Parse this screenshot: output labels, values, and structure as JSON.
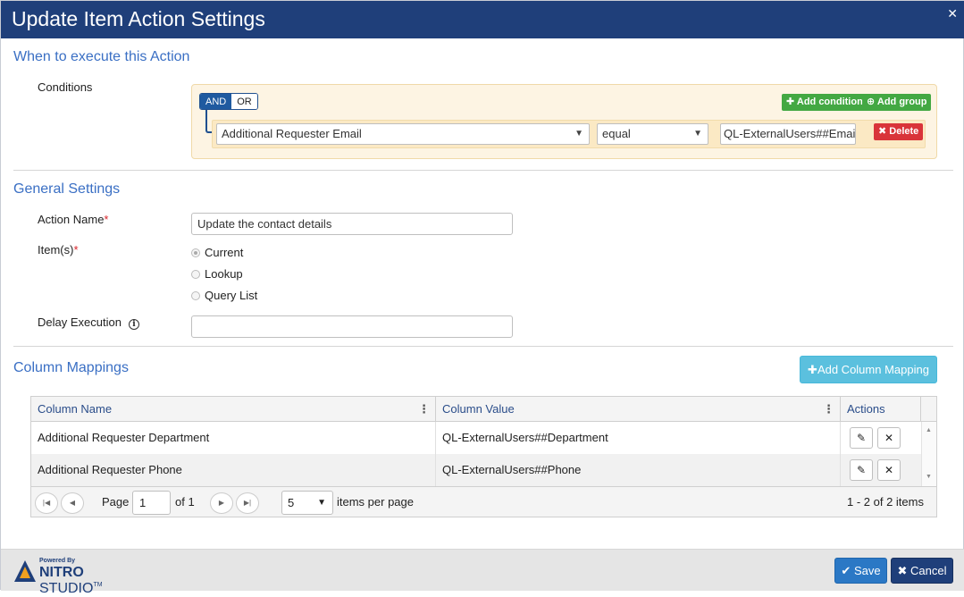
{
  "dialog": {
    "title": "Update Item Action Settings",
    "close_icon": "close-icon"
  },
  "when": {
    "section_title": "When to execute this Action",
    "conditions_label": "Conditions",
    "and_label": "AND",
    "or_label": "OR",
    "add_condition_label": "Add condition",
    "add_group_label": "Add group",
    "condition": {
      "field": "Additional Requester Email",
      "operator": "equal",
      "value": "QL-ExternalUsers##Email",
      "delete_label": "Delete"
    }
  },
  "general": {
    "section_title": "General Settings",
    "action_name_label": "Action Name",
    "action_name_value": "Update the contact details",
    "items_label": "Item(s)",
    "items_options": [
      "Current",
      "Lookup",
      "Query List"
    ],
    "items_selected": "Current",
    "delay_label": "Delay Execution",
    "delay_value": "",
    "required_mark": "*"
  },
  "mappings": {
    "section_title": "Column Mappings",
    "add_button_label": "Add Column Mapping",
    "columns": [
      "Column Name",
      "Column Value",
      "Actions"
    ],
    "rows": [
      {
        "name": "Additional Requester Department",
        "value": "QL-ExternalUsers##Department"
      },
      {
        "name": "Additional Requester Phone",
        "value": "QL-ExternalUsers##Phone"
      }
    ],
    "pager": {
      "page_label": "Page",
      "page_value": "1",
      "of_label": "of 1",
      "page_size": "5",
      "items_per_page_label": "items per page",
      "summary": "1 - 2 of 2 items"
    }
  },
  "footer": {
    "powered_by": "Powered By",
    "brand_bold": "NITRO",
    "brand_rest": " STUDIO",
    "trademark": "TM",
    "save_label": "Save",
    "cancel_label": "Cancel"
  },
  "colors": {
    "titlebar": "#1f3f7a",
    "section_title": "#3a6fc4",
    "green": "#43a843",
    "red": "#d9343a",
    "info_button": "#5bc0de",
    "save": "#2b78c5"
  }
}
